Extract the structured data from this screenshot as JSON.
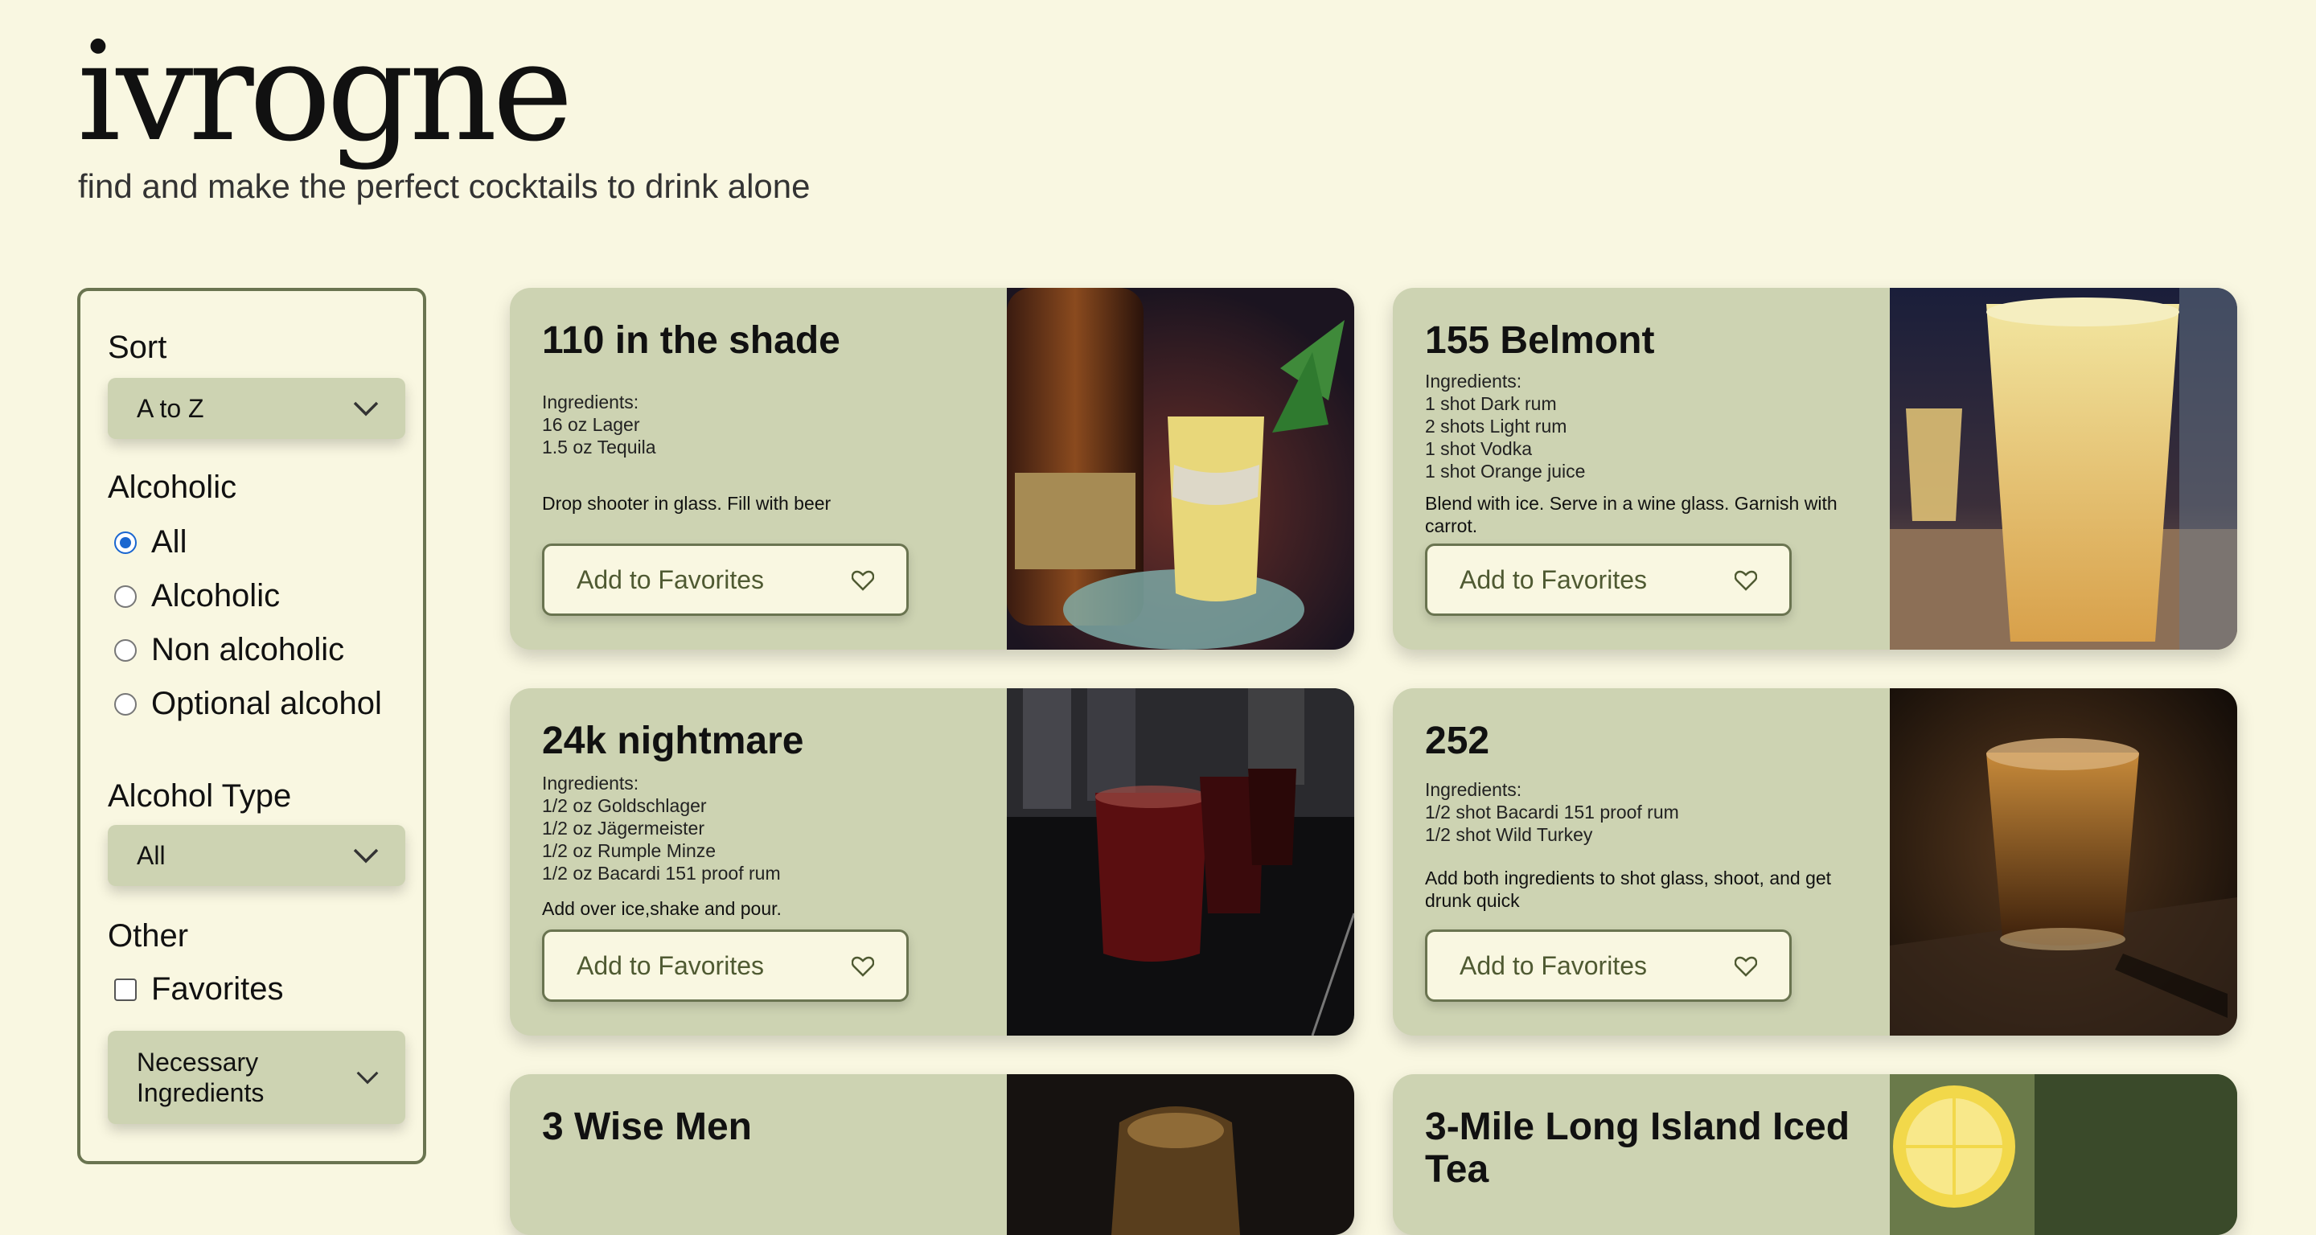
{
  "brand": {
    "name": "ivrogne",
    "tagline": "find and make the perfect cocktails to drink alone"
  },
  "filters": {
    "sort": {
      "label": "Sort",
      "value": "A to Z"
    },
    "alcoholic": {
      "label": "Alcoholic",
      "options": [
        "All",
        "Alcoholic",
        "Non alcoholic",
        "Optional alcohol"
      ],
      "selected": "All"
    },
    "alcohol_type": {
      "label": "Alcohol Type",
      "value": "All"
    },
    "other": {
      "label": "Other",
      "favorites_label": "Favorites",
      "favorites_checked": false,
      "ingredients_select": "Necessary Ingredients"
    }
  },
  "cards": [
    {
      "title": "110 in the shade",
      "ingredients_label": "Ingredients:",
      "ingredients": [
        "16 oz Lager",
        "1.5 oz Tequila"
      ],
      "instructions": "Drop shooter in glass. Fill with beer",
      "button": "Add to Favorites",
      "photo": "whiskey-bottle-and-glass"
    },
    {
      "title": "155 Belmont",
      "ingredients_label": "Ingredients:",
      "ingredients": [
        "1 shot Dark rum",
        "2 shots Light rum",
        "1 shot Vodka",
        "1 shot Orange juice"
      ],
      "instructions": "Blend with ice. Serve in a wine glass. Garnish with carrot.",
      "button": "Add to Favorites",
      "photo": "tall-yellow-drink"
    },
    {
      "title": "24k nightmare",
      "ingredients_label": "Ingredients:",
      "ingredients": [
        "1/2 oz Goldschlager",
        "1/2 oz Jägermeister",
        "1/2 oz Rumple Minze",
        "1/2 oz Bacardi 151 proof rum"
      ],
      "instructions": "Add over ice,shake and pour.",
      "button": "Add to Favorites",
      "photo": "red-shot-glasses"
    },
    {
      "title": "252",
      "ingredients_label": "Ingredients:",
      "ingredients": [
        "1/2 shot Bacardi 151 proof rum",
        "1/2 shot Wild Turkey"
      ],
      "instructions": "Add both ingredients to shot glass, shoot, and get drunk quick",
      "button": "Add to Favorites",
      "photo": "amber-shot-glass"
    },
    {
      "title": "3 Wise Men",
      "ingredients_label": "",
      "ingredients": [],
      "instructions": "",
      "button": "",
      "photo": "dark-glass"
    },
    {
      "title": "3-Mile Long Island Iced Tea",
      "ingredients_label": "",
      "ingredients": [],
      "instructions": "",
      "button": "",
      "photo": "lemon-slice"
    }
  ]
}
